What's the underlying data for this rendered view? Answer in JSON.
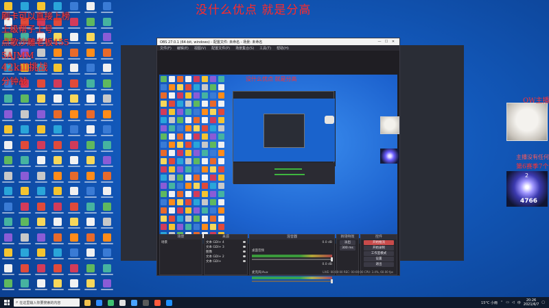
{
  "overlay": {
    "title": "没什么优点 就是分高",
    "lines": [
      "刷卡可以直接上榜",
      "上级帮子上号",
      "点歌沙雕老板455",
      "5AJMM",
      "42kill挑战",
      "分钟战"
    ],
    "ow_label": "OW主播认",
    "ow_note_1": "主播没有任何其他",
    "ow_note_2": "第6赛季7个第一"
  },
  "badge": {
    "level": "2",
    "score": "4766"
  },
  "obs": {
    "title": "OBS 27.0.1 (64-bit, windows) - 配置文件: 未命名 - 场景: 未命名",
    "menu": [
      "文件(F)",
      "编辑(E)",
      "视图(V)",
      "配置文件(P)",
      "场景集合(S)",
      "工具(T)",
      "帮助(H)"
    ],
    "preview_title": "没什么优点 就是分高",
    "docks": {
      "scenes": "场景",
      "sources": "来源",
      "mixer": "混音器",
      "transitions": "转场特效",
      "controls": "控件"
    },
    "scene_item": "场景",
    "sources": [
      "文本 GDI+ 4",
      "文本 GDI+ 3",
      "图像",
      "文本 GDI+ 2",
      "文本 GDI+"
    ],
    "mixer": [
      {
        "label": "桌面音频",
        "db": "0.0 dB"
      },
      {
        "label": "麦克风/Aux",
        "db": "0.0 dB"
      }
    ],
    "transition": "淡出",
    "duration": "300 ms",
    "controls": [
      "开始推流",
      "开始录制",
      "工作室模式",
      "设置",
      "退出"
    ],
    "status": "LIVE: 00:00:00   REC: 00:00:00   CPU: 3.4%, 60.00 fps"
  },
  "taskbar": {
    "search_placeholder": "在这里输入你要搜索的内容",
    "tray_weather": "15°C 小雨",
    "time": "20:26",
    "date": "2021/6/7",
    "lang": "中"
  },
  "colors": {
    "overlay_red": "#ff2a2a",
    "desktop_blue": "#1257b8",
    "obs_dark": "#1f1e23",
    "taskbar": "#0f1a2c"
  },
  "desktop_icon_colors": [
    "#f4c430",
    "#3a7bd5",
    "#e04a3a",
    "#5fb85f",
    "#f2f2f2",
    "#8a5cd6",
    "#ff8c1a",
    "#2aa5d9",
    "#f0f0f0",
    "#d23b5a",
    "#46b3a0",
    "#f7d75a",
    "#c8c8c8",
    "#e86a2b"
  ],
  "taskbar_app_colors": [
    "#f2c14e",
    "#2f8cff",
    "#3ec070",
    "#e0e0e0",
    "#4aa3ff",
    "#5a5a5a",
    "#ff5a3c",
    "#1e90ff"
  ]
}
